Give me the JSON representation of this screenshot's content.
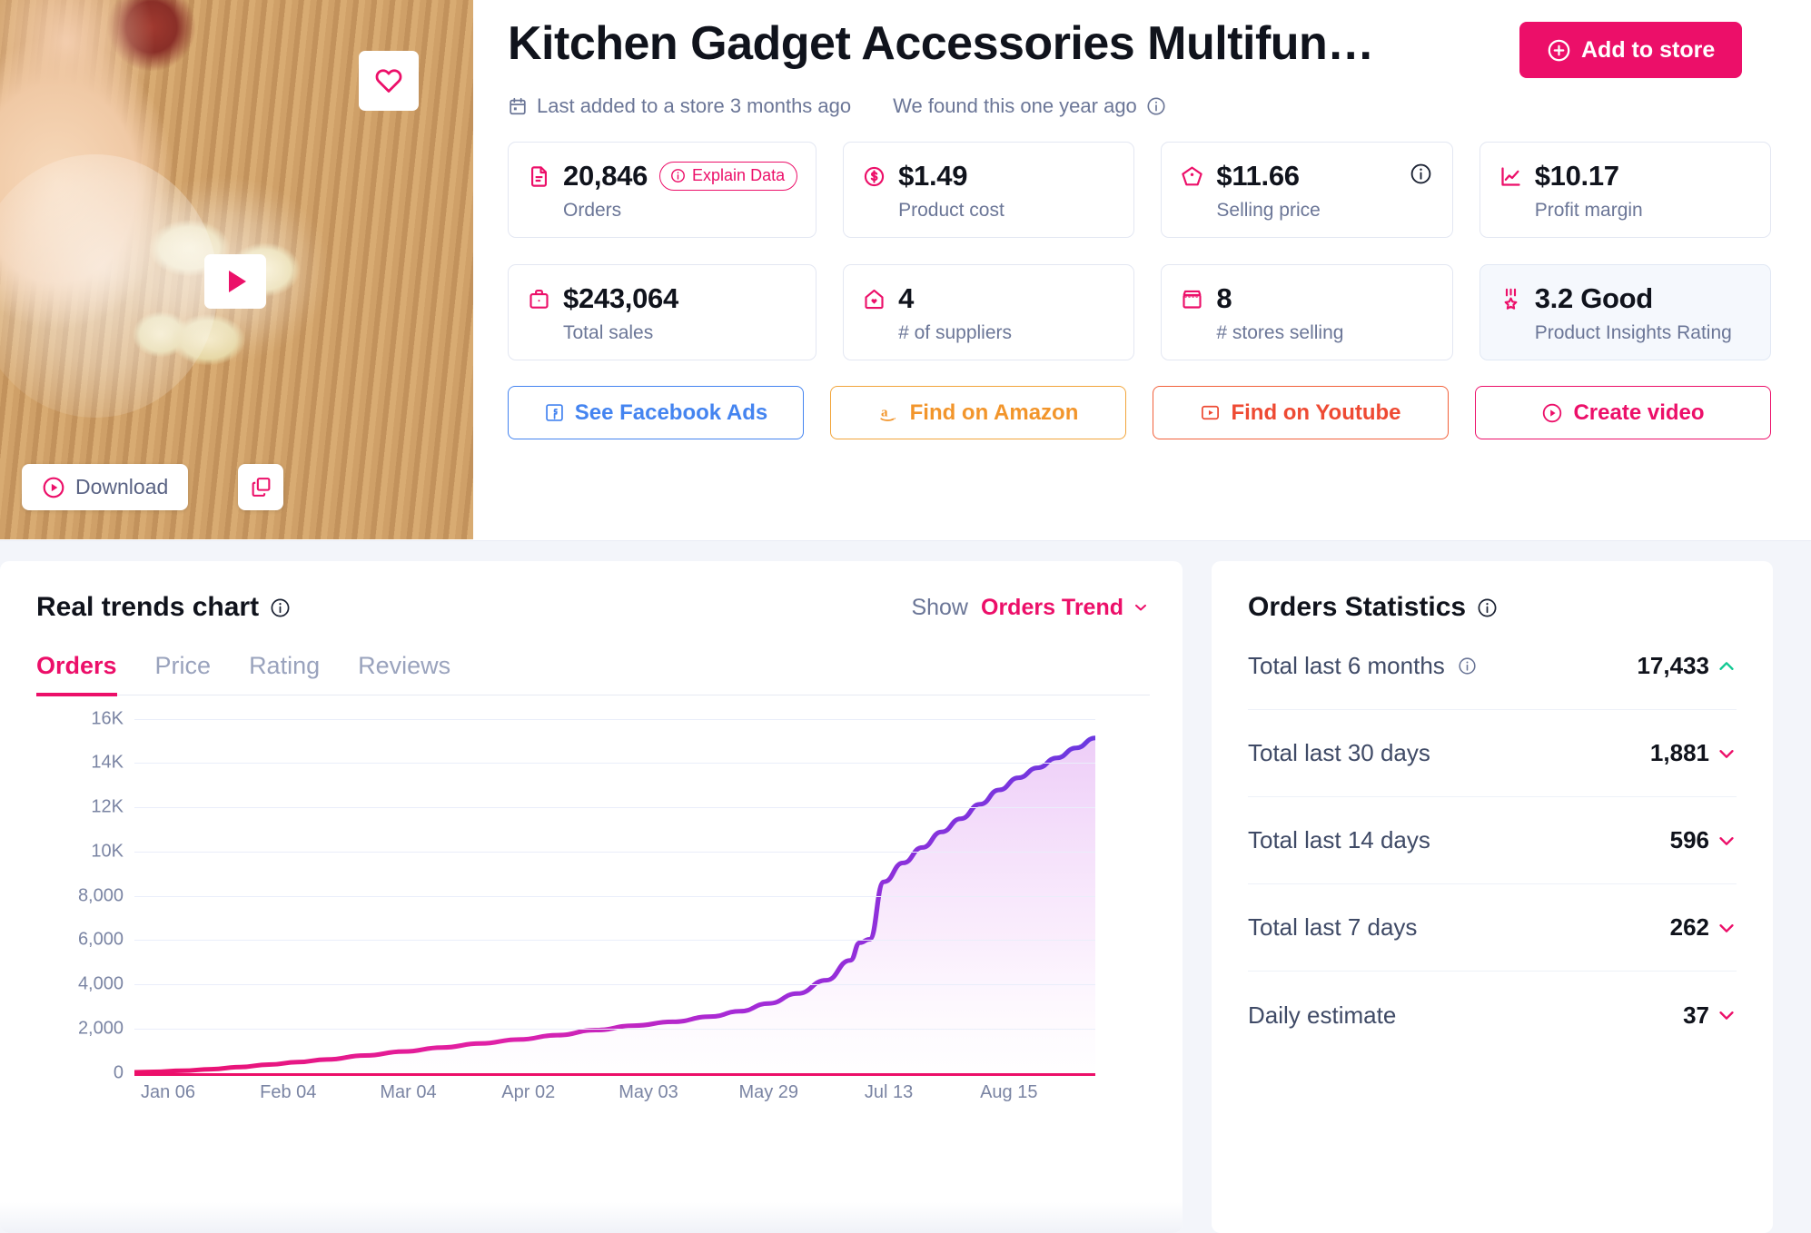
{
  "product": {
    "title": "Kitchen Gadget Accessories Multifun…",
    "add_to_store_label": "Add to store",
    "last_added": "Last added to a store 3 months ago",
    "found": "We found this one year ago",
    "download_label": "Download"
  },
  "metrics": [
    {
      "value": "20,846",
      "label": "Orders",
      "icon": "document-icon",
      "pill": "Explain Data"
    },
    {
      "value": "$1.49",
      "label": "Product cost",
      "icon": "coin-icon"
    },
    {
      "value": "$11.66",
      "label": "Selling price",
      "icon": "tag-icon",
      "info": true
    },
    {
      "value": "$10.17",
      "label": "Profit margin",
      "icon": "chart-icon"
    },
    {
      "value": "$243,064",
      "label": "Total sales",
      "icon": "briefcase-icon"
    },
    {
      "value": "4",
      "label": "# of suppliers",
      "icon": "home-heart-icon"
    },
    {
      "value": "8",
      "label": "# stores selling",
      "icon": "storefront-icon"
    },
    {
      "value": "3.2 Good",
      "label": "Product Insights Rating",
      "icon": "medal-icon",
      "highlight": true
    }
  ],
  "links": [
    {
      "label": "See Facebook Ads",
      "icon": "facebook-icon",
      "style": "lb-fb"
    },
    {
      "label": "Find on Amazon",
      "icon": "amazon-icon",
      "style": "lb-az"
    },
    {
      "label": "Find on Youtube",
      "icon": "youtube-icon",
      "style": "lb-yt"
    },
    {
      "label": "Create video",
      "icon": "play-circle-icon",
      "style": "lb-cv"
    }
  ],
  "chart_panel": {
    "title": "Real trends chart",
    "show_label": "Show",
    "show_value": "Orders Trend",
    "tabs": [
      {
        "label": "Orders",
        "active": true
      },
      {
        "label": "Price",
        "active": false
      },
      {
        "label": "Rating",
        "active": false
      },
      {
        "label": "Reviews",
        "active": false
      }
    ]
  },
  "chart_data": {
    "type": "area",
    "title": "Real trends chart",
    "series_name": "Orders Trend",
    "xlabel": "",
    "ylabel": "",
    "ylim": [
      0,
      16000
    ],
    "grid": true,
    "legend": "none",
    "ytick_labels": [
      "0",
      "2,000",
      "4,000",
      "6,000",
      "8,000",
      "10K",
      "12K",
      "14K",
      "16K"
    ],
    "ytick_values": [
      0,
      2000,
      4000,
      6000,
      8000,
      10000,
      12000,
      14000,
      16000
    ],
    "xtick_labels": [
      "Jan 06",
      "Feb 04",
      "Mar 04",
      "Apr 02",
      "May 03",
      "May 29",
      "Jul 13",
      "Aug 15"
    ],
    "xtick_positions": [
      0.035,
      0.16,
      0.285,
      0.41,
      0.535,
      0.66,
      0.785,
      0.91
    ],
    "line_color_start": "#ec0f69",
    "line_color_end": "#6b38e0",
    "x": [
      0,
      0.02,
      0.05,
      0.08,
      0.11,
      0.14,
      0.17,
      0.2,
      0.24,
      0.28,
      0.32,
      0.36,
      0.4,
      0.44,
      0.48,
      0.52,
      0.56,
      0.6,
      0.63,
      0.66,
      0.69,
      0.72,
      0.745,
      0.755,
      0.765,
      0.78,
      0.8,
      0.82,
      0.84,
      0.86,
      0.88,
      0.9,
      0.92,
      0.94,
      0.96,
      0.98,
      1.0
    ],
    "values": [
      40,
      60,
      110,
      180,
      280,
      390,
      500,
      620,
      800,
      980,
      1160,
      1340,
      1520,
      1720,
      1950,
      2150,
      2320,
      2560,
      2800,
      3150,
      3600,
      4200,
      5100,
      5900,
      6050,
      8650,
      9500,
      10200,
      10900,
      11500,
      12150,
      12800,
      13350,
      13800,
      14250,
      14700,
      15150
    ]
  },
  "stats_panel": {
    "title": "Orders Statistics",
    "rows": [
      {
        "label": "Total last 6 months",
        "value": "17,433",
        "trend": "up",
        "info": true
      },
      {
        "label": "Total last 30 days",
        "value": "1,881",
        "trend": "down",
        "info": false
      },
      {
        "label": "Total last 14 days",
        "value": "596",
        "trend": "down",
        "info": false
      },
      {
        "label": "Total last 7 days",
        "value": "262",
        "trend": "down",
        "info": false
      },
      {
        "label": "Daily estimate",
        "value": "37",
        "trend": "down",
        "info": false
      }
    ]
  },
  "colors": {
    "brand": "#ec0f69",
    "green": "#12c993",
    "purple": "#6b38e0"
  }
}
